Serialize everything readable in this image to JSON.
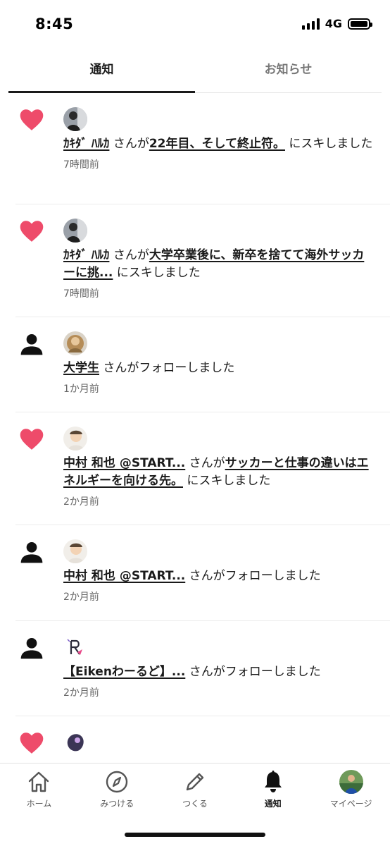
{
  "status_bar": {
    "time": "8:45",
    "network": "4G"
  },
  "tabs": [
    {
      "label": "通知",
      "active": true
    },
    {
      "label": "お知らせ",
      "active": false
    }
  ],
  "notifications": [
    {
      "type": "like",
      "icon": "heart-icon",
      "user": "ｶｷﾀﾞ ﾊﾙｶ",
      "middle": " さんが",
      "article": "22年目、そして終止符。",
      "suffix": " にスキしました",
      "time": "7時間前"
    },
    {
      "type": "like",
      "icon": "heart-icon",
      "user": "ｶｷﾀﾞ ﾊﾙｶ",
      "middle": " さんが",
      "article": "大学卒業後に、新卒を捨てて海外サッカーに挑...",
      "suffix": " にスキしました",
      "time": "7時間前"
    },
    {
      "type": "follow",
      "icon": "person-icon",
      "user": "大学生",
      "middle": " さんがフォローしました",
      "time": "1か月前"
    },
    {
      "type": "like",
      "icon": "heart-icon",
      "user": "中村 和也 @START...",
      "middle": " さんが",
      "article": "サッカーと仕事の違いはエネルギーを向ける先。",
      "suffix": " にスキしました",
      "time": "2か月前"
    },
    {
      "type": "follow",
      "icon": "person-icon",
      "user": "中村 和也 @START...",
      "middle": " さんがフォローしました",
      "time": "2か月前"
    },
    {
      "type": "follow",
      "icon": "person-icon",
      "user": "【Eikenわーるど】...",
      "middle": " さんがフォローしました",
      "time": "2か月前"
    },
    {
      "type": "like",
      "icon": "heart-icon"
    }
  ],
  "bottom_nav": [
    {
      "label": "ホーム",
      "icon": "home-icon"
    },
    {
      "label": "みつける",
      "icon": "compass-icon"
    },
    {
      "label": "つくる",
      "icon": "pencil-icon"
    },
    {
      "label": "通知",
      "icon": "bell-icon",
      "active": true
    },
    {
      "label": "マイページ",
      "icon": "avatar-icon"
    }
  ],
  "colors": {
    "heart": "#ee4b6a",
    "text": "#1a1a1a",
    "muted": "#666666",
    "divider": "#ececec"
  }
}
